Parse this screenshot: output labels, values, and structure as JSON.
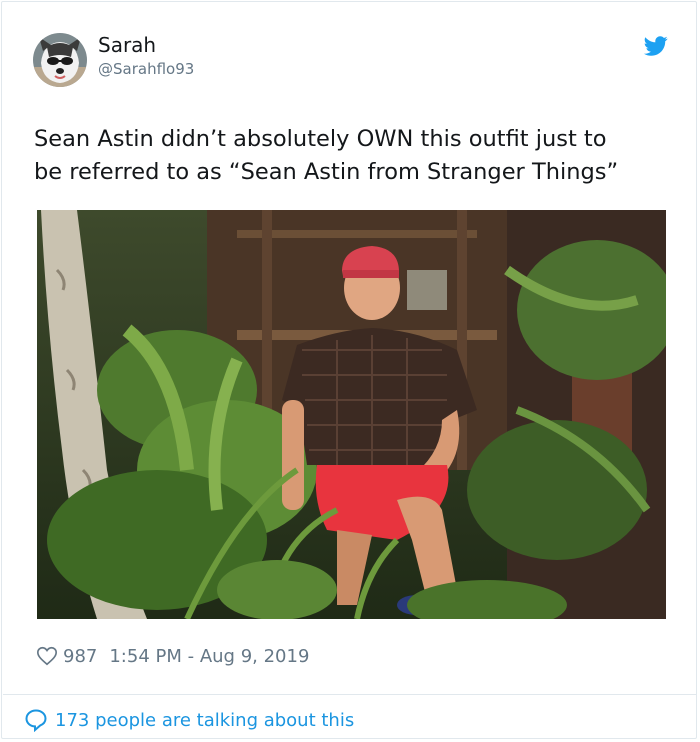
{
  "author": {
    "name": "Sarah",
    "handle": "@Sarahflo93"
  },
  "tweet": {
    "lines": [
      "Sean Astin didn’t absolutely OWN this outfit just to",
      "be referred to as “Sean Astin from Stranger Things”"
    ]
  },
  "meta": {
    "likes": "987",
    "timestamp": "1:54 PM - Aug 9, 2019"
  },
  "footer": {
    "talking": "173 people are talking about this"
  },
  "icons": {
    "brand": "twitter-bird-icon",
    "like": "heart-icon",
    "reply": "speech-bubble-icon"
  },
  "colors": {
    "twitter_blue": "#1da1f2",
    "link_blue": "#1b95e0",
    "muted": "#657786",
    "text": "#14171a"
  }
}
